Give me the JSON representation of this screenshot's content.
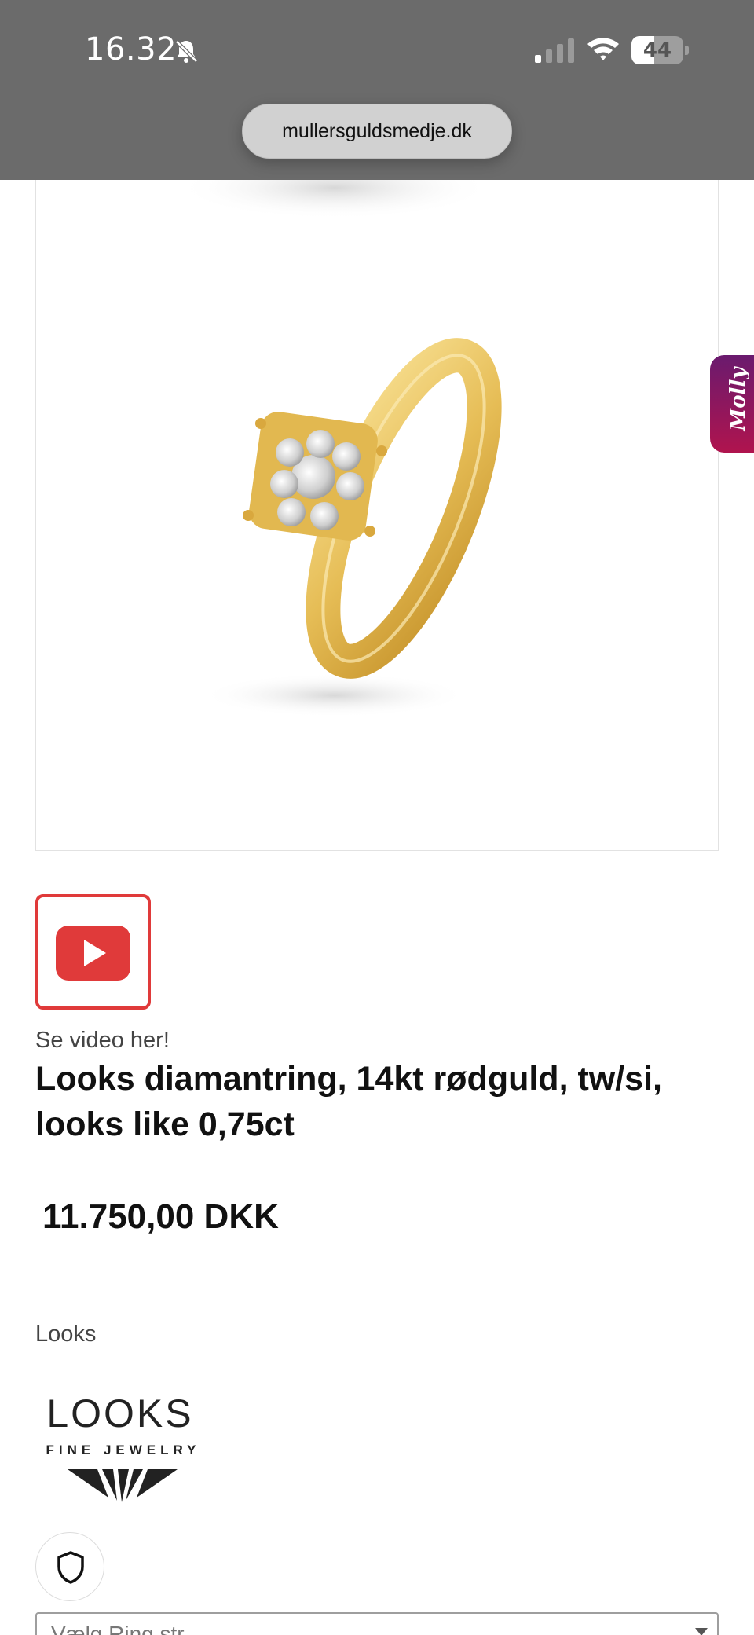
{
  "status_bar": {
    "time": "16.32",
    "battery": "44",
    "battery_level": 0.44,
    "icons": [
      "bell-slash-icon",
      "cellular-signal-icon",
      "wifi-icon",
      "battery-icon"
    ]
  },
  "browser": {
    "url": "mullersguldsmedje.dk"
  },
  "product": {
    "image": "gold-diamond-ring-image",
    "video_button_icon": "youtube-play-icon",
    "video_caption": "Se video her!",
    "title": "Looks diamantring, 14kt rødguld, tw/si, looks like 0,75ct",
    "price": "11.750,00 DKK",
    "brand_label": "Looks"
  },
  "brand_logo": {
    "word": "LOOKS",
    "subtitle": "FINE JEWELRY"
  },
  "molly_tab": {
    "label": "Molly",
    "colors": [
      "#6a1a6e",
      "#b0144e"
    ]
  },
  "trust_badge": {
    "icon": "shield-icon"
  },
  "size_select": {
    "placeholder": "Vælg Ring str."
  },
  "colors": {
    "header_bg": "#6b6b6b",
    "video_red": "#e03a3a",
    "gold": "#e8c35a"
  }
}
